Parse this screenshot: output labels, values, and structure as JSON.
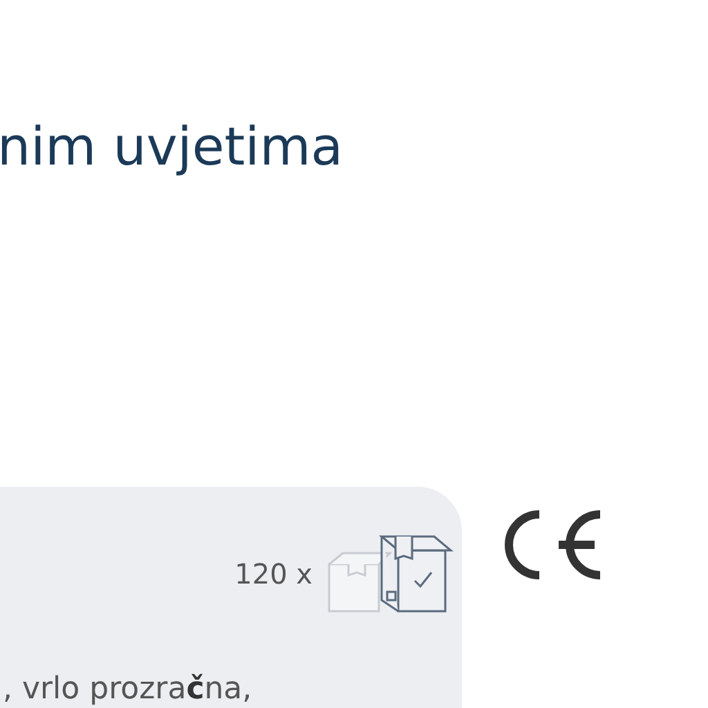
{
  "heading": "nim uvjetima",
  "package": {
    "quantity": "120 x"
  },
  "description": ", vrlo prozra**č**na,"
}
